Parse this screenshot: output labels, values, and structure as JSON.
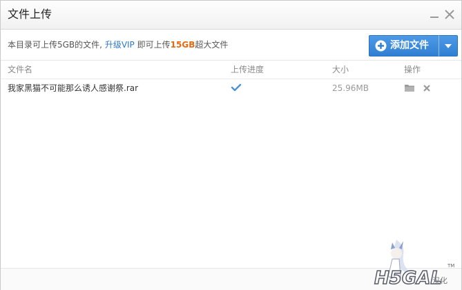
{
  "window": {
    "title": "文件上传",
    "minimize_icon": "minimize-icon",
    "close_icon": "close-icon"
  },
  "info": {
    "prefix": "本目录可上传5GB的文件,",
    "vip_link": "升级VIP",
    "middle": "即可上传",
    "highlight": "15GB",
    "suffix": "超大文件",
    "highlight_color": "#e36a12",
    "link_color": "#2e78c8"
  },
  "add_button": {
    "label": "添加文件",
    "icon": "plus-circle-icon",
    "dropdown_icon": "caret-down-icon",
    "color": "#3586d8"
  },
  "table": {
    "columns": [
      "文件名",
      "上传进度",
      "大小",
      "操作"
    ],
    "rows": [
      {
        "name": "我家黑猫不可能那么诱人感谢祭.rar",
        "progress_icon": "check-icon",
        "progress": 1,
        "size": "25.96MB",
        "actions": [
          "folder-icon",
          "remove-icon"
        ]
      }
    ]
  },
  "watermark": {
    "logo": "H5GAL",
    "caption": "汉化",
    "tm": "TM"
  }
}
